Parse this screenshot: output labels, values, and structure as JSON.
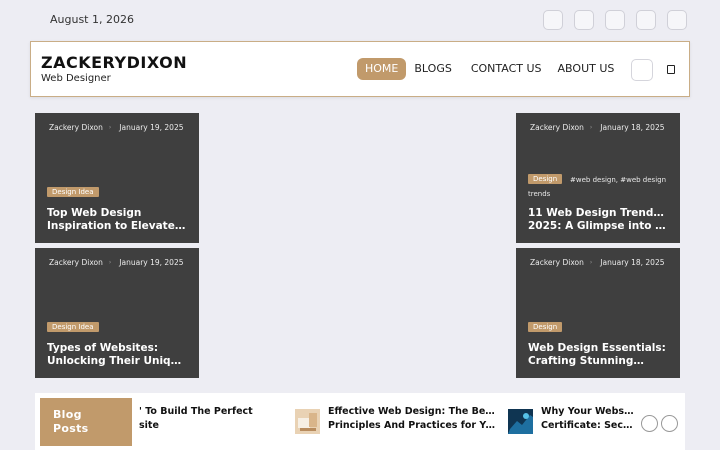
{
  "topbar": {
    "date": "August 1, 2026",
    "date_icon": "calendar-icon",
    "extra_icon": "clock-icon",
    "socials": [
      {
        "name": "facebook-icon",
        "glyph": ""
      },
      {
        "name": "twitter-icon",
        "glyph": ""
      },
      {
        "name": "instagram-icon",
        "glyph": ""
      },
      {
        "name": "linkedin-icon",
        "glyph": ""
      },
      {
        "name": "youtube-icon",
        "glyph": ""
      }
    ]
  },
  "header": {
    "brand": "ZACKERYDIXON",
    "tagline": "Web Designer",
    "nav": [
      {
        "label": "HOME",
        "active": true,
        "dropdown": false
      },
      {
        "label": "BLOGS",
        "active": false,
        "dropdown": true
      },
      {
        "label": "CONTACT US",
        "active": false,
        "dropdown": false
      },
      {
        "label": "ABOUT US",
        "active": false,
        "dropdown": true
      }
    ],
    "dropdown_glyph": "",
    "theme_toggle_glyph": "",
    "search_icon": "search-icon"
  },
  "cards": [
    {
      "author": "Zackery Dixon",
      "date": "January 19, 2025",
      "category": "Design Idea",
      "tags": "",
      "title_lines": [
        "Top Web Design",
        "Inspiration to Elevate…"
      ]
    },
    {
      "author": "Zackery Dixon",
      "date": "January 18, 2025",
      "category": "Design",
      "tags": "#web design, #web design trends",
      "tags_line1": "#web design, #web design",
      "tags_line2": "trends",
      "title_lines": [
        "11 Web Design Trends in",
        "2025: A Glimpse into th…"
      ]
    },
    {
      "author": "Zackery Dixon",
      "date": "January 19, 2025",
      "category": "Design Idea",
      "tags": "",
      "title_lines": [
        "Types of Websites:",
        "Unlocking Their Uniqu…"
      ]
    },
    {
      "author": "Zackery Dixon",
      "date": "January 18, 2025",
      "category": "Design",
      "tags": "",
      "title_lines": [
        "Web Design Essentials:",
        "Crafting Stunning…"
      ]
    }
  ],
  "meta_glyphs": {
    "author": "",
    "sep": "›",
    "date": "",
    "tag": ""
  },
  "strip": {
    "label_line1": "Blog",
    "label_line2": "Posts",
    "posts": [
      {
        "line1": "' To Build The Perfect",
        "line2": "site"
      },
      {
        "line1": "Effective Web Design: The Best",
        "line2": "Principles And Practices for Yo…"
      },
      {
        "line1": "Why Your Website",
        "line2": "Certificate: Securi"
      }
    ],
    "prev_glyph": "",
    "next_glyph": ""
  },
  "colors": {
    "accent": "#c19a6b",
    "card_bg": "#3f3f3f",
    "page_bg": "#ededf3"
  }
}
